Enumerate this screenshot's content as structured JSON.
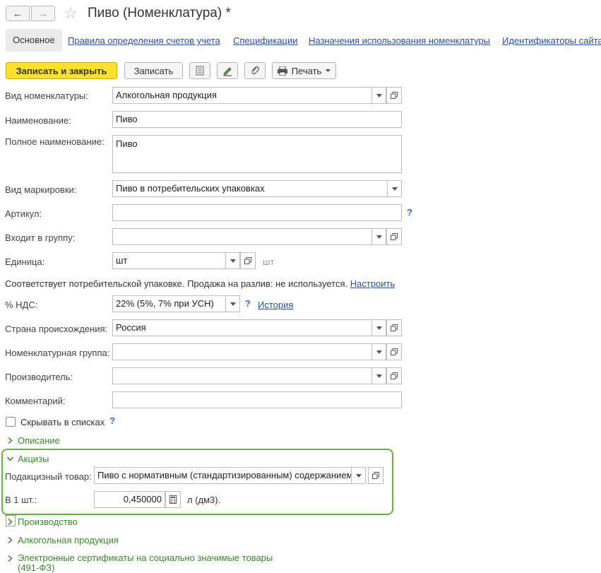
{
  "window": {
    "title": "Пиво (Номенклатура) *"
  },
  "tabs": [
    {
      "label": "Основное"
    },
    {
      "label": "Правила определения счетов учета"
    },
    {
      "label": "Спецификации"
    },
    {
      "label": "Назначения использования номенклатуры"
    },
    {
      "label": "Идентификаторы сайта"
    }
  ],
  "toolbar": {
    "save_close_label": "Записать и закрыть",
    "save_label": "Записать",
    "print_label": "Печать"
  },
  "form": {
    "vid_label": "Вид номенклатуры:",
    "vid_value": "Алкогольная продукция",
    "name_label": "Наименование:",
    "name_value": "Пиво",
    "fullname_label": "Полное наименование:",
    "fullname_value": "Пиво",
    "marking_label": "Вид маркировки:",
    "marking_value": "Пиво в потребительских упаковках",
    "article_label": "Артикул:",
    "article_value": "",
    "group_label": "Входит в группу:",
    "group_value": "",
    "unit_label": "Единица:",
    "unit_value": "шт",
    "unit_suffix": "шт",
    "package_text": "Соответствует потребительской упаковке. Продажа на разлив: не используется.",
    "package_link": "Настроить",
    "vat_label": "% НДС:",
    "vat_value": "22% (5%, 7% при УСН)",
    "vat_history": "История",
    "country_label": "Страна происхождения:",
    "country_value": "Россия",
    "nomgroup_label": "Номенклатурная группа:",
    "nomgroup_value": "",
    "producer_label": "Производитель:",
    "producer_value": "",
    "comment_label": "Комментарий:",
    "comment_value": "",
    "hide_label": "Скрывать в списках",
    "help_mark": "?"
  },
  "sections": {
    "description": "Описание",
    "excise": "Акцизы",
    "excise_goods_label": "Подакцизный товар:",
    "excise_goods_value": "Пиво с нормативным (стандартизированным) содержанием",
    "per_unit_label": "В 1 шт.:",
    "per_unit_value": "0,450000",
    "per_unit_suffix": "л (дм3).",
    "production": "Производство",
    "alcohol": "Алкогольная продукция",
    "certificates_line1": "Электронные сертификаты на социально значимые товары",
    "certificates_line2": "(491-ФЗ)"
  },
  "colors": {
    "primary_button": "#fde12d",
    "link": "#2a50a0",
    "section_green": "#3a8a2a",
    "highlight_border": "#66b33a"
  }
}
